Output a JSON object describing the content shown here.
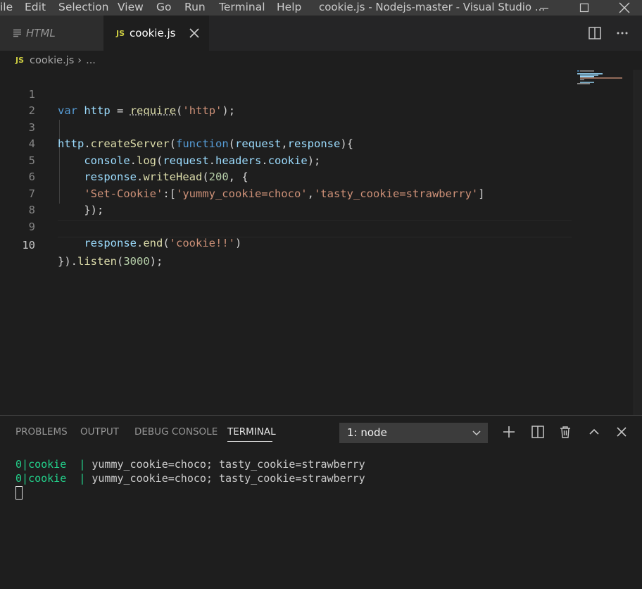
{
  "titlebar": {
    "menu": [
      "ile",
      "Edit",
      "Selection",
      "View",
      "Go",
      "Run",
      "Terminal",
      "Help"
    ],
    "title": "cookie.js - Nodejs-master - Visual Studio ..."
  },
  "tabs": [
    {
      "label": "HTML",
      "icon": "menu-lines-icon"
    },
    {
      "label": "cookie.js",
      "icon": "js-file-icon",
      "badge": "JS"
    }
  ],
  "breadcrumb": {
    "badge": "JS",
    "file": "cookie.js",
    "separator": "›",
    "rest": "..."
  },
  "editor": {
    "line_numbers": [
      "1",
      "2",
      "3",
      "4",
      "5",
      "6",
      "7",
      "8",
      "9",
      "10"
    ],
    "active_line": 10
  },
  "panel": {
    "tabs": [
      "PROBLEMS",
      "OUTPUT",
      "DEBUG CONSOLE",
      "TERMINAL"
    ],
    "active_tab": "TERMINAL",
    "terminal_select": "1: node",
    "terminal_lines": [
      {
        "id": "0",
        "name": "cookie",
        "sep": "|",
        "text": "yummy_cookie=choco; tasty_cookie=strawberry"
      },
      {
        "id": "0",
        "name": "cookie",
        "sep": "|",
        "text": "yummy_cookie=choco; tasty_cookie=strawberry"
      }
    ]
  },
  "colors": {
    "editor_bg": "#1e1e1e",
    "titlebar_bg": "#3c3c3c",
    "keyword": "#569cd6",
    "function": "#dcdcaa",
    "variable": "#9cdcfe",
    "string": "#ce9178",
    "number": "#b5cea8",
    "terminal_green": "#23d18b",
    "js_badge": "#cbcb41"
  }
}
